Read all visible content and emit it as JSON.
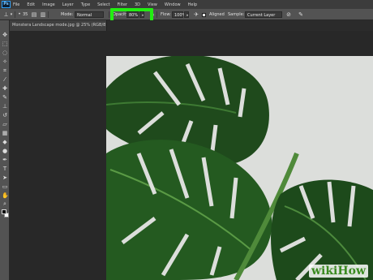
{
  "app": {
    "logo_text": "Ps"
  },
  "menu": [
    "File",
    "Edit",
    "Image",
    "Layer",
    "Type",
    "Select",
    "Filter",
    "3D",
    "View",
    "Window",
    "Help"
  ],
  "options_bar": {
    "tool_icon": "clone-stamp-icon",
    "brush_size": "35",
    "mode_label": "Mode:",
    "mode_value": "Normal",
    "opacity_label": "Opacity:",
    "opacity_value": "80%",
    "flow_label": "Flow:",
    "flow_value": "100%",
    "aligned_label": "Aligned",
    "aligned_checked": true,
    "sample_label": "Sample:",
    "sample_value": "Current Layer",
    "highlight_color": "#22ee11"
  },
  "document": {
    "tab_title": "Monstera Landscape mode.jpg @ 25% (RGB/8) *"
  },
  "tools": [
    "move-icon",
    "marquee-icon",
    "lasso-icon",
    "quick-select-icon",
    "crop-icon",
    "eyedropper-icon",
    "healing-brush-icon",
    "brush-icon",
    "clone-stamp-icon",
    "history-brush-icon",
    "eraser-icon",
    "gradient-icon",
    "blur-icon",
    "dodge-icon",
    "pen-icon",
    "type-icon",
    "path-select-icon",
    "rectangle-icon",
    "hand-icon",
    "zoom-icon"
  ],
  "colors": {
    "foreground": "#000000",
    "background": "#ffffff"
  },
  "watermark": "wikiHow"
}
